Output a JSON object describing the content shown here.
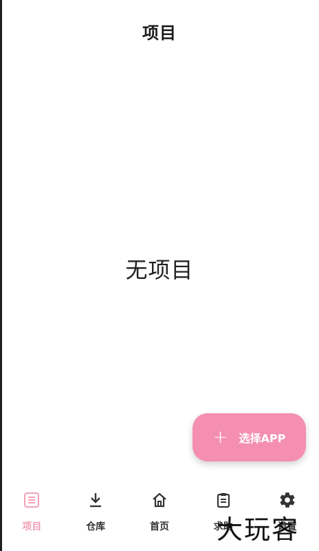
{
  "header": {
    "title": "项目"
  },
  "main": {
    "empty_text": "无项目"
  },
  "fab": {
    "icon": "plus-icon",
    "label": "选择APP",
    "color": "#f48fb1"
  },
  "bottom_nav": {
    "items": [
      {
        "label": "项目",
        "icon": "list-doc-icon",
        "active": true
      },
      {
        "label": "仓库",
        "icon": "download-icon",
        "active": false
      },
      {
        "label": "首页",
        "icon": "home-icon",
        "active": false
      },
      {
        "label": "求助",
        "icon": "clipboard-icon",
        "active": false
      },
      {
        "label": "设置",
        "icon": "gear-icon",
        "active": false
      }
    ],
    "active_color": "#f2a0b8",
    "inactive_color": "#333333"
  },
  "watermark": {
    "text": "大玩客"
  }
}
